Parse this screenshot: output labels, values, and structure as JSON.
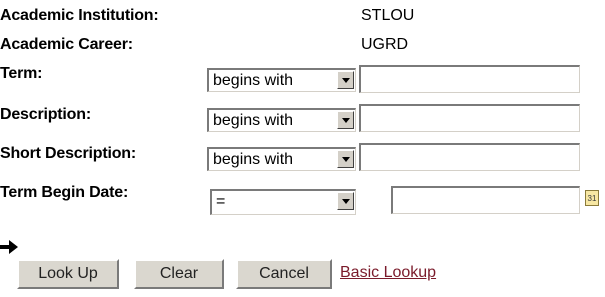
{
  "fields": {
    "institution_label": "Academic Institution:",
    "institution_value": "STLOU",
    "career_label": "Academic Career:",
    "career_value": "UGRD",
    "term_label": "Term:",
    "term_operator": "begins with",
    "term_value": "",
    "description_label": "Description:",
    "description_operator": "begins with",
    "description_value": "",
    "short_description_label": "Short Description:",
    "short_description_operator": "begins with",
    "short_description_value": "",
    "term_begin_date_label": "Term Begin Date:",
    "term_begin_date_operator": "=",
    "term_begin_date_value": "",
    "calendar_icon_text": "31"
  },
  "buttons": {
    "lookup_label": "Look Up",
    "clear_label": "Clear",
    "cancel_label": "Cancel",
    "basic_lookup_label": "Basic Lookup"
  },
  "icons": {
    "dropdown": "chevron-down-icon",
    "calendar": "calendar-icon",
    "focus_arrow": "arrow-right-icon"
  },
  "colors": {
    "link": "#7a1a2a",
    "button_face": "#dad7cf",
    "calendar": "#f7e7a3"
  }
}
